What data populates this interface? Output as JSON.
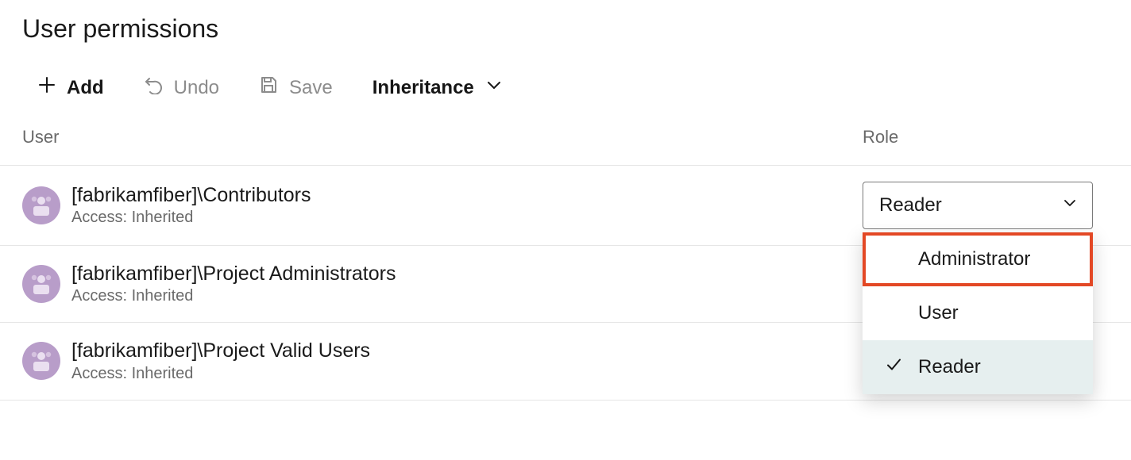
{
  "title": "User permissions",
  "toolbar": {
    "add": "Add",
    "undo": "Undo",
    "save": "Save",
    "inheritance": "Inheritance"
  },
  "columns": {
    "user": "User",
    "role": "Role"
  },
  "access_label_prefix": "Access: ",
  "rows": [
    {
      "name": "[fabrikamfiber]\\Contributors",
      "access": "Inherited",
      "role": "Reader"
    },
    {
      "name": "[fabrikamfiber]\\Project Administrators",
      "access": "Inherited",
      "role": ""
    },
    {
      "name": "[fabrikamfiber]\\Project Valid Users",
      "access": "Inherited",
      "role": ""
    }
  ],
  "role_dropdown": {
    "options": [
      "Administrator",
      "User",
      "Reader"
    ],
    "selected": "Reader",
    "highlighted": "Administrator"
  },
  "colors": {
    "highlight_border": "#e34825",
    "avatar_bg": "#b89dc9"
  }
}
